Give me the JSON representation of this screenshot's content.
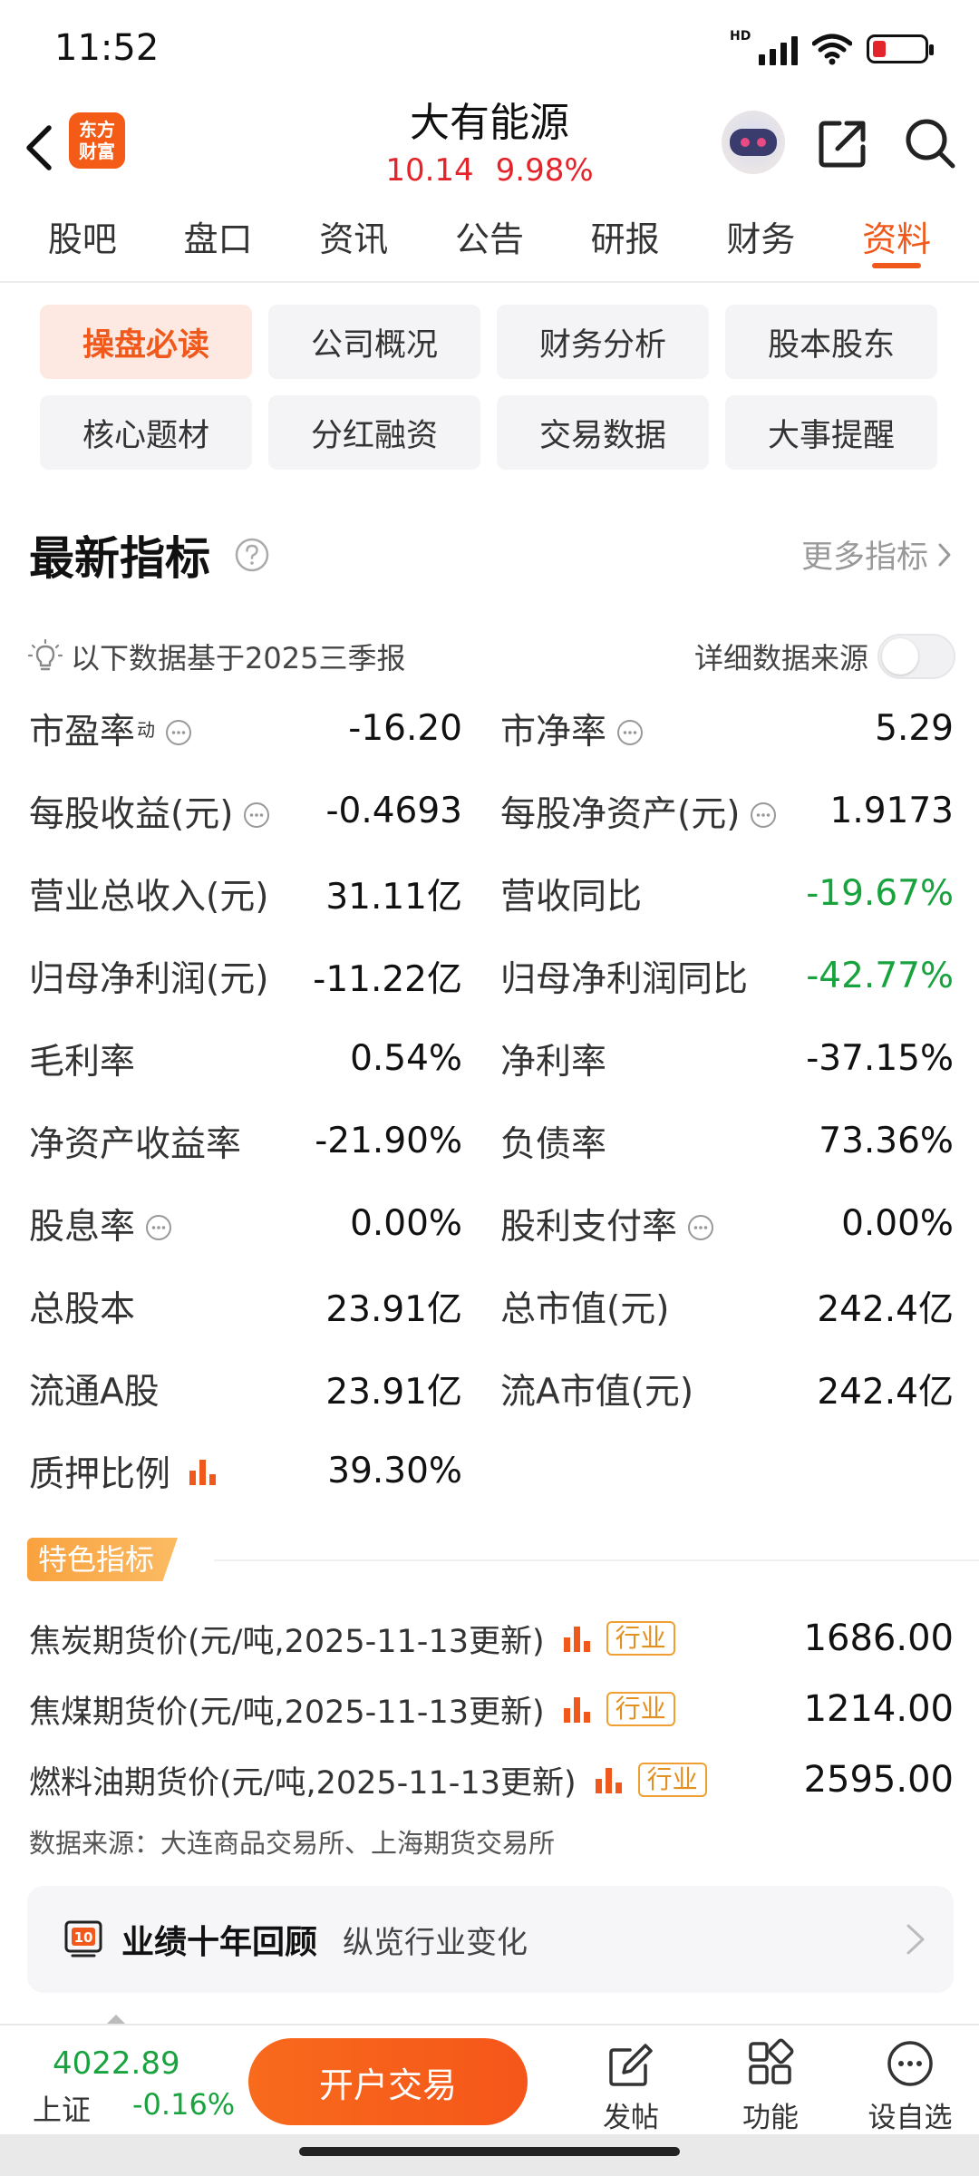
{
  "status_bar": {
    "time": "11:52",
    "network": "HD"
  },
  "header": {
    "logo_line1": "东方",
    "logo_line2": "财富",
    "stock_name": "大有能源",
    "price": "10.14",
    "change_pct": "9.98%"
  },
  "tabs": [
    {
      "label": "股吧"
    },
    {
      "label": "盘口"
    },
    {
      "label": "资讯"
    },
    {
      "label": "公告"
    },
    {
      "label": "研报"
    },
    {
      "label": "财务"
    },
    {
      "label": "资料",
      "active": true
    }
  ],
  "sub_buttons": [
    {
      "label": "操盘必读",
      "active": true
    },
    {
      "label": "公司概况"
    },
    {
      "label": "财务分析"
    },
    {
      "label": "股本股东"
    },
    {
      "label": "核心题材"
    },
    {
      "label": "分红融资"
    },
    {
      "label": "交易数据"
    },
    {
      "label": "大事提醒"
    }
  ],
  "section": {
    "title": "最新指标",
    "more_label": "更多指标",
    "note": "以下数据基于2025三季报",
    "detail_source_label": "详细数据来源",
    "detail_source_toggle": false
  },
  "metrics": [
    {
      "label": "市盈率",
      "sup": "动",
      "value": "-16.20"
    },
    {
      "label": "市净率",
      "value": "5.29"
    },
    {
      "label": "每股收益(元)",
      "value": "-0.4693"
    },
    {
      "label": "每股净资产(元)",
      "value": "1.9173"
    },
    {
      "label": "营业总收入(元)",
      "value": "31.11亿"
    },
    {
      "label": "营收同比",
      "value": "-19.67%",
      "color": "green"
    },
    {
      "label": "归母净利润(元)",
      "value": "-11.22亿"
    },
    {
      "label": "归母净利润同比",
      "value": "-42.77%",
      "color": "green"
    },
    {
      "label": "毛利率",
      "value": "0.54%"
    },
    {
      "label": "净利率",
      "value": "-37.15%"
    },
    {
      "label": "净资产收益率",
      "value": "-21.90%"
    },
    {
      "label": "负债率",
      "value": "73.36%"
    },
    {
      "label": "股息率",
      "value": "0.00%"
    },
    {
      "label": "股利支付率",
      "value": "0.00%"
    },
    {
      "label": "总股本",
      "value": "23.91亿"
    },
    {
      "label": "总市值(元)",
      "value": "242.4亿"
    },
    {
      "label": "流通A股",
      "value": "23.91亿"
    },
    {
      "label": "流A市值(元)",
      "value": "242.4亿"
    },
    {
      "label": "质押比例",
      "value": "39.30%"
    }
  ],
  "special": {
    "tag": "特色指标",
    "rows": [
      {
        "label": "焦炭期货价(元/吨,2025-11-13更新)",
        "tag": "行业",
        "value": "1686.00"
      },
      {
        "label": "焦煤期货价(元/吨,2025-11-13更新)",
        "tag": "行业",
        "value": "1214.00"
      },
      {
        "label": "燃料油期货价(元/吨,2025-11-13更新)",
        "tag": "行业",
        "value": "2595.00"
      }
    ],
    "source": "数据来源：大连商品交易所、上海期货交易所"
  },
  "review": {
    "icon_text": "10",
    "title": "业绩十年回顾",
    "subtitle": "纵览行业变化"
  },
  "bottom_bar": {
    "index_value": "4022.89",
    "index_name": "上证",
    "index_change": "-0.16%",
    "trade_label": "开户交易",
    "post_label": "发帖",
    "func_label": "功能",
    "watch_label": "设自选"
  },
  "colors": {
    "accent": "#f0591b",
    "up_red": "#e3242b",
    "down_green": "#19a33f",
    "tag_orange": "#f9a23f"
  }
}
